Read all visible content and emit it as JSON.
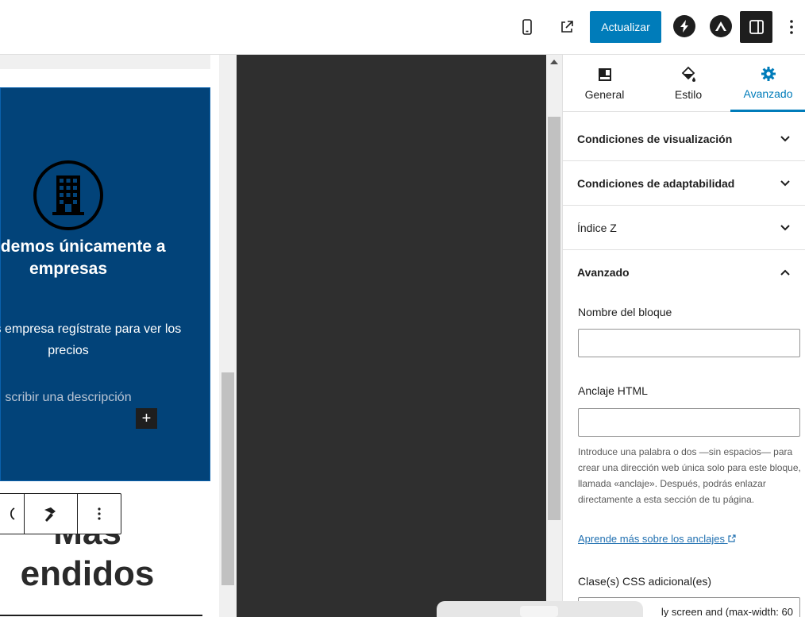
{
  "topbar": {
    "update_label": "Actualizar",
    "icons": [
      "mobile-preview-icon",
      "external-link-icon",
      "spectra-icon",
      "astra-icon",
      "sidebar-toggle-icon",
      "kebab-menu-icon"
    ],
    "accent": "#007cba"
  },
  "canvas": {
    "card": {
      "title": "Vendemos únicamente a empresas",
      "description": "Si tenes empresa regístrate para ver los precios",
      "placeholder": "scribir una descripción",
      "add_label": "+",
      "bg": "#024379"
    },
    "heading_line1": "Mas",
    "heading_line2": "endidos"
  },
  "sidebar": {
    "tabs": [
      {
        "label": "General",
        "icon": "layout-icon"
      },
      {
        "label": "Estilo",
        "icon": "paint-bucket-icon"
      },
      {
        "label": "Avanzado",
        "icon": "gear-icon",
        "active": true
      }
    ],
    "panels": [
      {
        "label": "Condiciones de visualización",
        "expanded": false
      },
      {
        "label": "Condiciones de adaptabilidad",
        "expanded": false
      },
      {
        "label": "Índice Z",
        "expanded": false
      },
      {
        "label": "Avanzado",
        "expanded": true
      }
    ],
    "advanced": {
      "block_name_label": "Nombre del bloque",
      "block_name_value": "",
      "anchor_label": "Anclaje HTML",
      "anchor_value": "",
      "anchor_help": "Introduce una palabra o dos —sin espacios— para crear una dirección web única solo para este bloque, llamada «anclaje». Después, podrás enlazar directamente a esta sección de tu página.",
      "anchor_link": "Aprende más sobre los anclajes",
      "css_label": "Clase(s) CSS adicional(es)",
      "css_value": "ly screen and (max-width: 60"
    }
  }
}
